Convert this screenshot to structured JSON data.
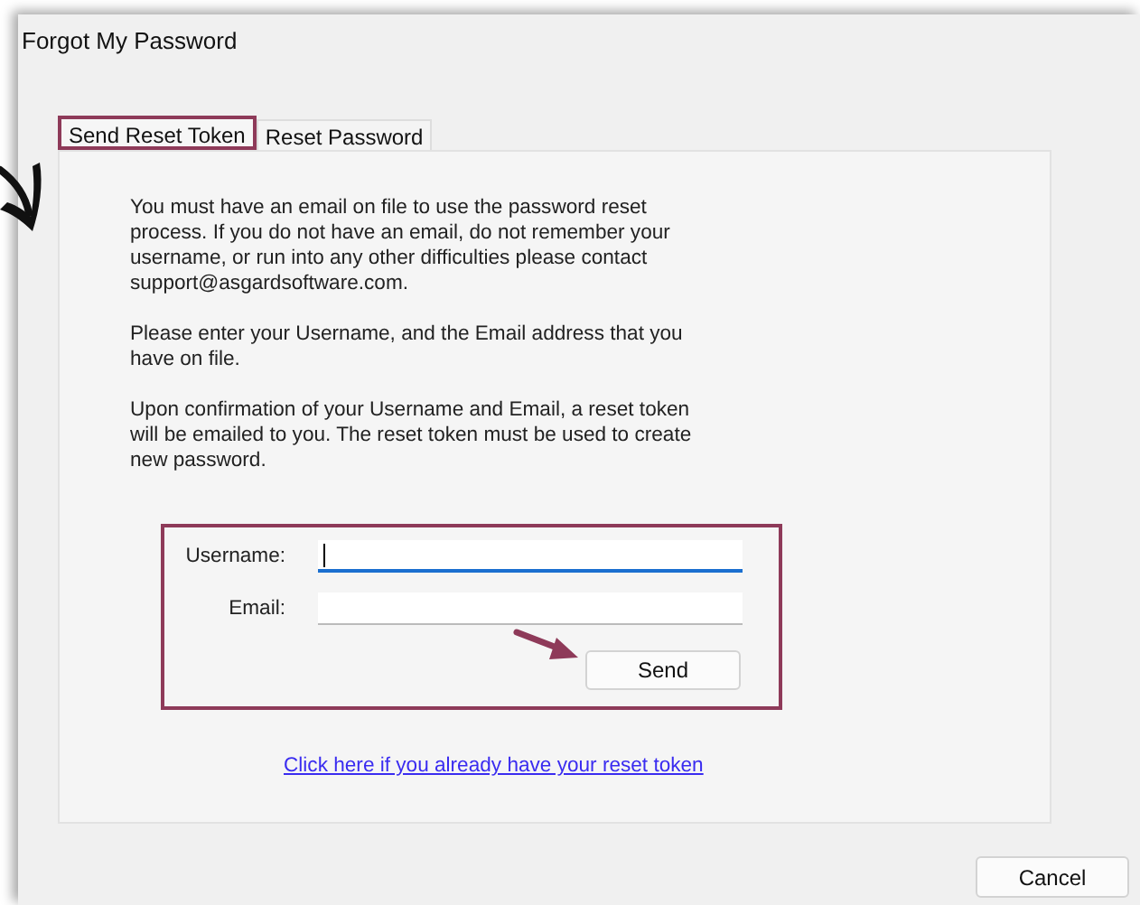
{
  "window": {
    "title": "Forgot My Password"
  },
  "tabs": [
    {
      "label": "Send Reset Token",
      "selected": true
    },
    {
      "label": "Reset Password",
      "selected": false
    }
  ],
  "paragraphs": [
    "You must have an email on file to use the password reset process. If you do not have an email, do not remember your username, or run into any other difficulties please contact support@asgardsoftware.com.",
    "Please enter your Username, and the Email address that you have on file.",
    "Upon confirmation of your Username and Email, a reset token will be emailed to you.  The reset token must be used to create new password."
  ],
  "form": {
    "fields": [
      {
        "label": "Username:",
        "focused": true
      },
      {
        "label": "Email:",
        "focused": false
      }
    ],
    "submit": "Send"
  },
  "link": "Click here if you already have your reset token",
  "buttons": [
    "Cancel"
  ]
}
